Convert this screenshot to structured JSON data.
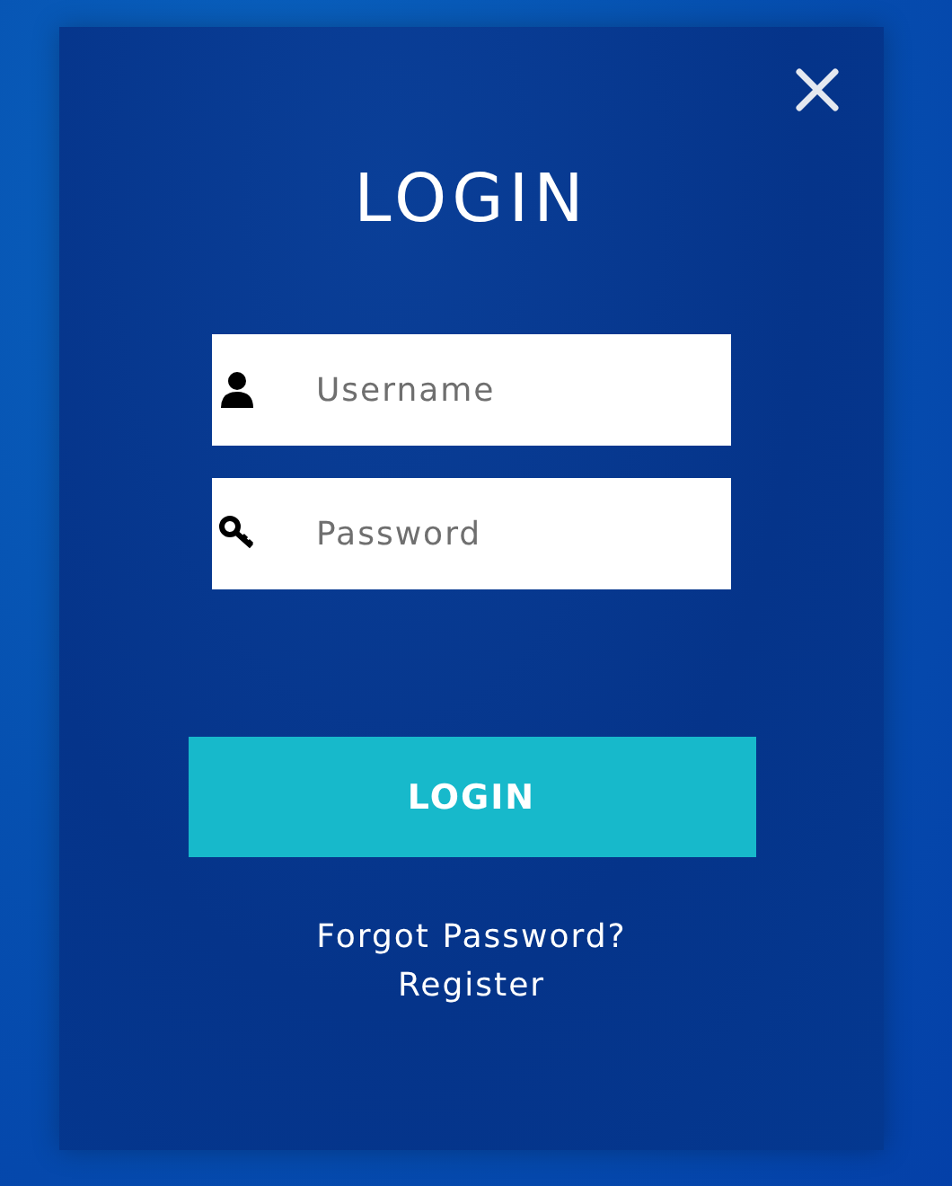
{
  "dialog": {
    "title": "LOGIN",
    "fields": [
      {
        "kind": "user",
        "placeholder": "Username"
      },
      {
        "kind": "password",
        "placeholder": "Password"
      }
    ],
    "submit": "LOGIN",
    "links": [
      "Forgot Password?",
      "Register"
    ]
  }
}
